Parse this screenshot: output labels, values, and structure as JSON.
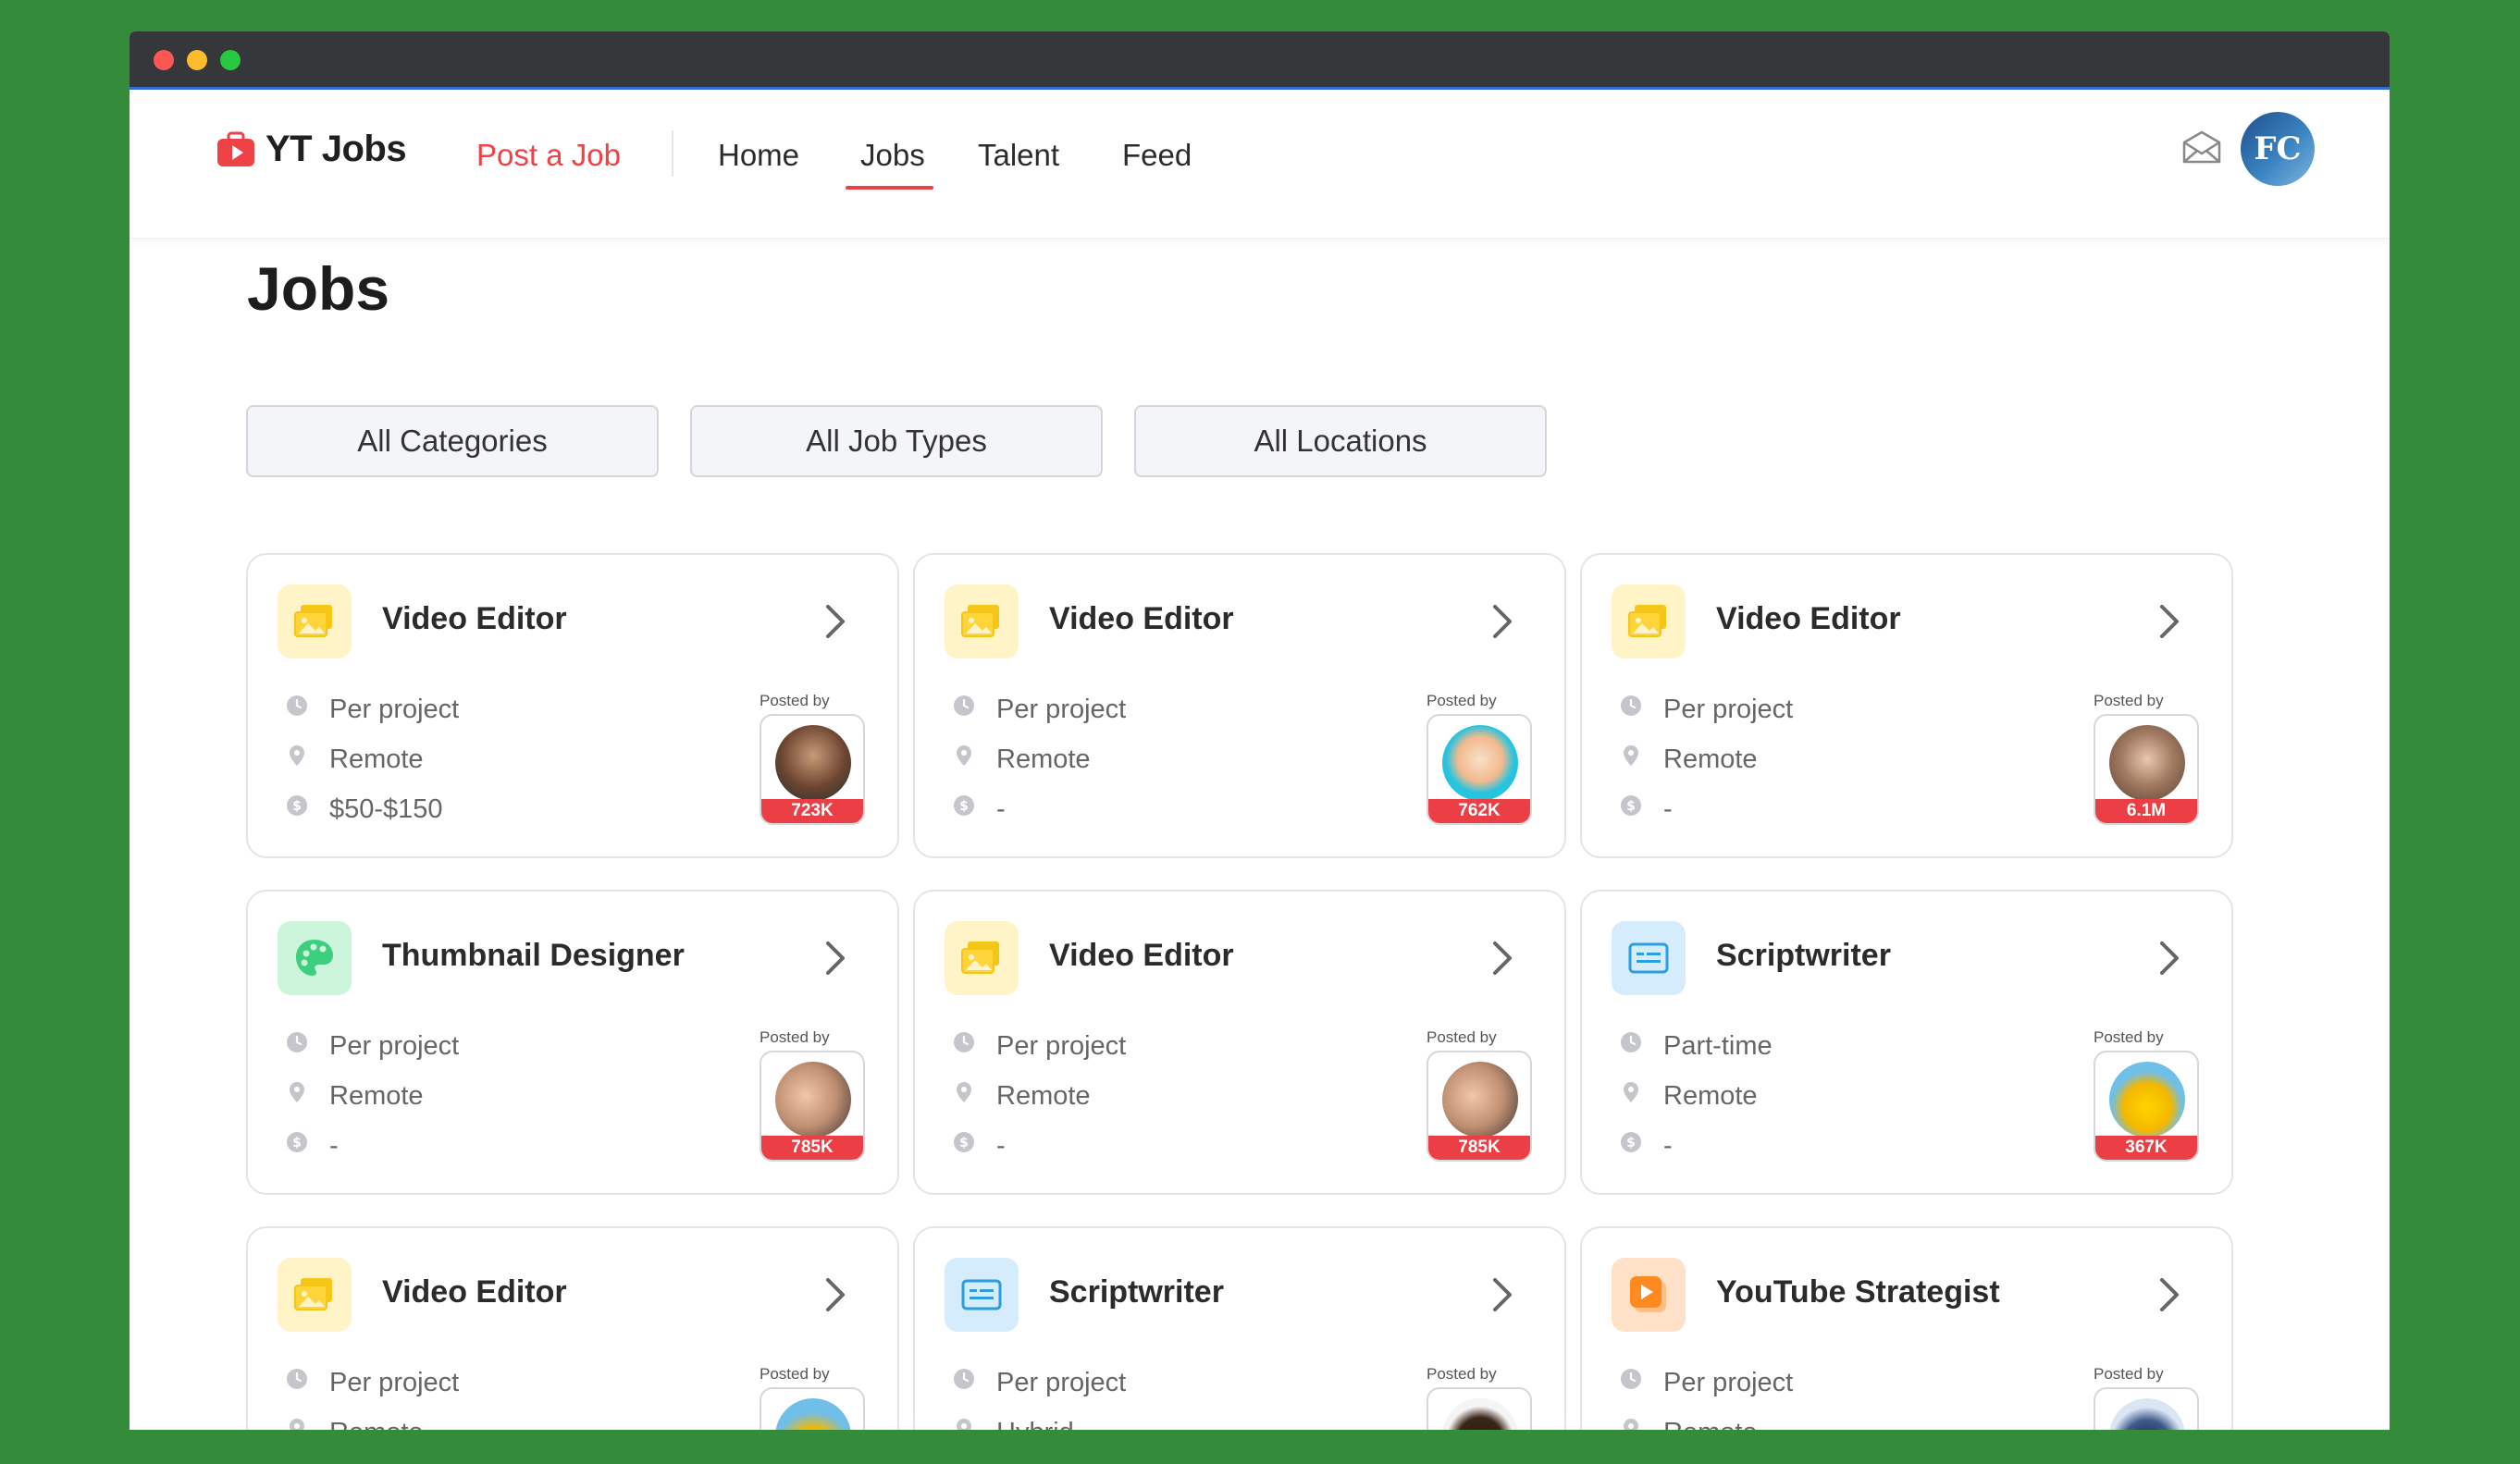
{
  "app": {
    "logo_text": "YT Jobs"
  },
  "nav": {
    "post_job": "Post a Job",
    "links": [
      "Home",
      "Jobs",
      "Talent",
      "Feed"
    ],
    "avatar_initials": "FC",
    "active": "Jobs"
  },
  "page": {
    "title": "Jobs"
  },
  "filters": [
    "All Categories",
    "All Job Types",
    "All Locations"
  ],
  "posted_by_label": "Posted by",
  "cards": [
    {
      "title": "Video Editor",
      "icon": "video-image-icon",
      "type": "Per project",
      "location": "Remote",
      "pay": "$50-$150",
      "subs": "723K"
    },
    {
      "title": "Video Editor",
      "icon": "video-image-icon",
      "type": "Per project",
      "location": "Remote",
      "pay": "-",
      "subs": "762K"
    },
    {
      "title": "Video Editor",
      "icon": "video-image-icon",
      "type": "Per project",
      "location": "Remote",
      "pay": "-",
      "subs": "6.1M"
    },
    {
      "title": "Thumbnail Designer",
      "icon": "palette-icon",
      "type": "Per project",
      "location": "Remote",
      "pay": "-",
      "subs": "785K"
    },
    {
      "title": "Video Editor",
      "icon": "video-image-icon",
      "type": "Per project",
      "location": "Remote",
      "pay": "-",
      "subs": "785K"
    },
    {
      "title": "Scriptwriter",
      "icon": "script-icon",
      "type": "Part-time",
      "location": "Remote",
      "pay": "-",
      "subs": "367K"
    },
    {
      "title": "Video Editor",
      "icon": "video-image-icon",
      "type": "Per project",
      "location": "Remote",
      "pay": "",
      "subs": ""
    },
    {
      "title": "Scriptwriter",
      "icon": "script-icon",
      "type": "Per project",
      "location": "Hybrid",
      "pay": "",
      "subs": ""
    },
    {
      "title": "YouTube Strategist",
      "icon": "play-icon",
      "type": "Per project",
      "location": "Remote",
      "pay": "",
      "subs": ""
    }
  ],
  "colors": {
    "accent": "#ef4146",
    "background": "#348c3b",
    "titlebar": "#35373a"
  }
}
